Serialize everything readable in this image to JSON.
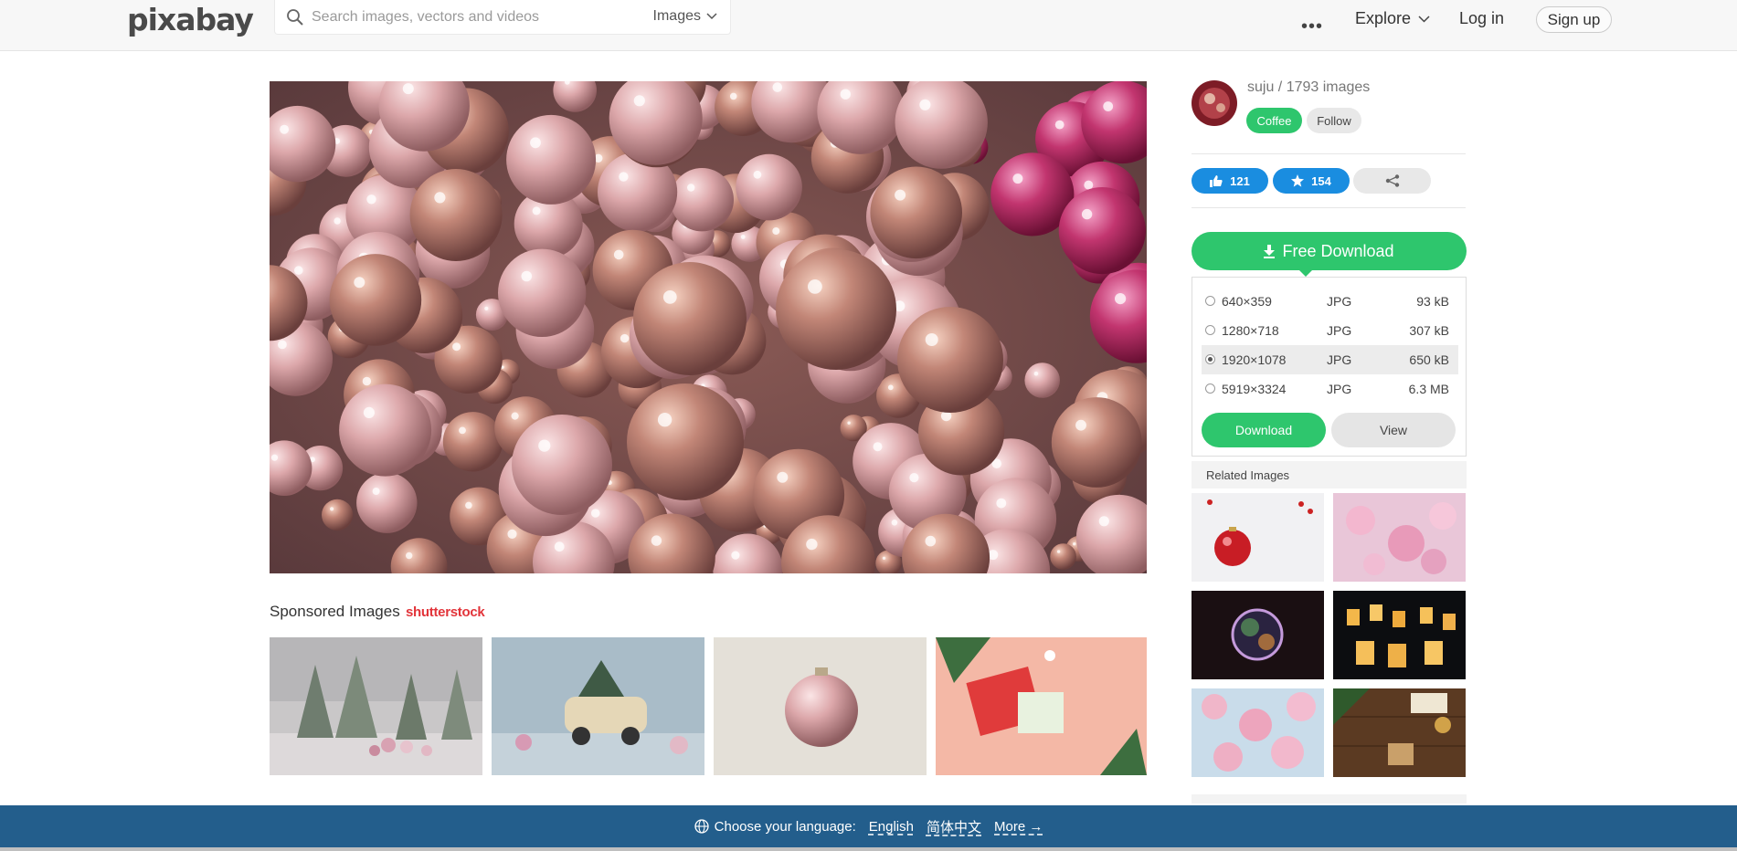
{
  "header": {
    "logo": "pixabay",
    "search_placeholder": "Search images, vectors and videos",
    "search_type": "Images",
    "more_dots": "•••",
    "explore": "Explore",
    "login": "Log in",
    "signup": "Sign up"
  },
  "sponsored": {
    "title": "Sponsored Images",
    "provider_logo": "shutterstock"
  },
  "user": {
    "name_line": "suju / 1793 images",
    "coffee_label": "Coffee",
    "follow_label": "Follow"
  },
  "stats": {
    "likes": "121",
    "favorites": "154"
  },
  "download": {
    "free_download_label": "Free Download",
    "options": [
      {
        "resolution": "640×359",
        "format": "JPG",
        "size": "93 kB",
        "selected": false
      },
      {
        "resolution": "1280×718",
        "format": "JPG",
        "size": "307 kB",
        "selected": false
      },
      {
        "resolution": "1920×1078",
        "format": "JPG",
        "size": "650 kB",
        "selected": true
      },
      {
        "resolution": "5919×3324",
        "format": "JPG",
        "size": "6.3 MB",
        "selected": false
      }
    ],
    "download_button": "Download",
    "view_button": "View"
  },
  "related": {
    "title": "Related Images"
  },
  "footer": {
    "choose_language": "Choose your language:",
    "english": "English",
    "chinese": "简体中文",
    "more": "More →"
  },
  "colors": {
    "accent_green": "#2ec66d",
    "accent_blue": "#1a8de0",
    "footer_blue": "#235e8c"
  }
}
